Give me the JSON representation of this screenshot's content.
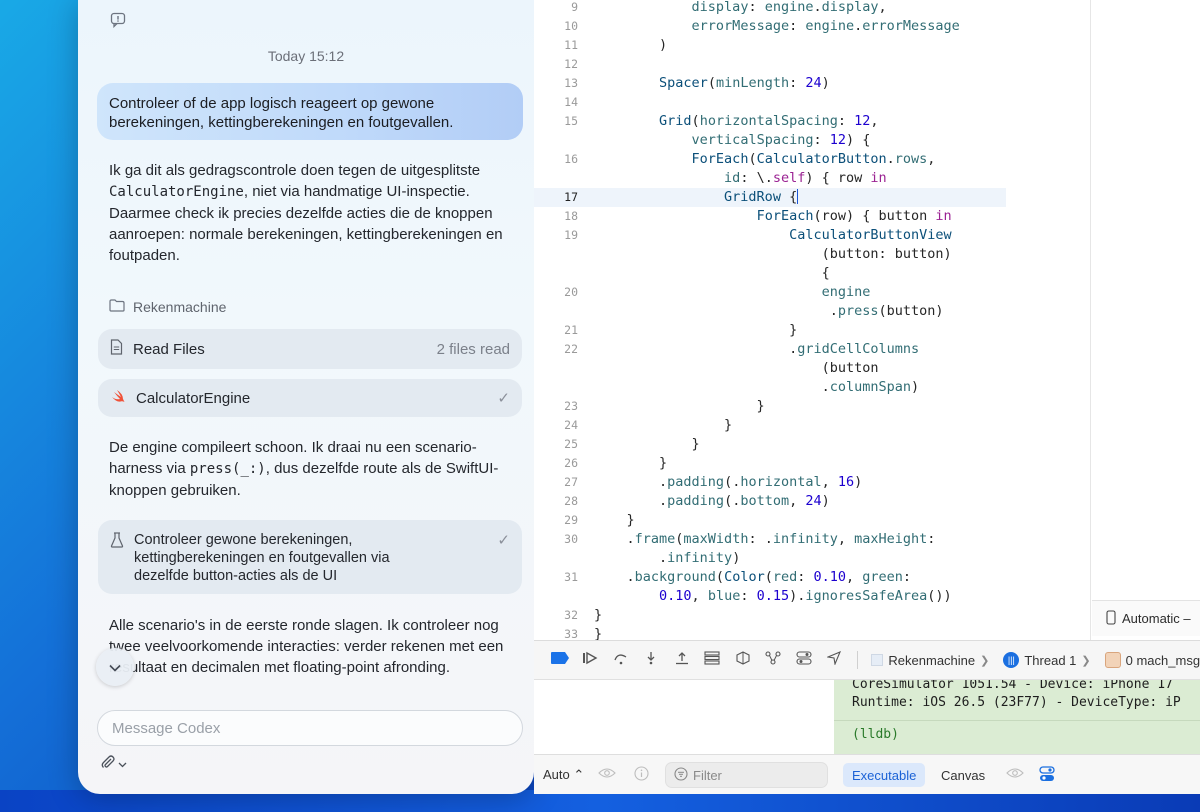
{
  "chat": {
    "timestamp": "Today 15:12",
    "user_message": "Controleer of de app logisch reageert op gewone berekeningen, kettingberekeningen en foutgevallen.",
    "reply1": {
      "part1": "Ik ga dit als gedragscontrole doen tegen de uitgesplitste ",
      "code": "CalculatorEngine",
      "part2": ", niet via handmatige UI-inspectie. Daarmee check ik precies dezelfde acties die de knoppen aanroepen: normale berekeningen, kettingberekeningen en foutpaden."
    },
    "folder_label": "Rekenmachine",
    "read_files": {
      "label": "Read Files",
      "meta": "2 files read"
    },
    "engine_card": {
      "label": "CalculatorEngine",
      "check": "✓"
    },
    "reply2": {
      "part1": "De engine compileert schoon. Ik draai nu een scenario-harness via ",
      "code": "press(_:)",
      "part2": ", dus dezelfde route als de SwiftUI-knoppen gebruiken."
    },
    "test_card": {
      "line1": "Controleer gewone berekeningen,",
      "line2": "kettingberekeningen en foutgevallen via",
      "line3": "dezelfde button-acties als de UI",
      "check": "✓"
    },
    "reply3": "Alle scenario's in de eerste ronde slagen. Ik controleer nog twee veelvoorkomende interacties: verder rekenen met een resultaat en decimalen met floating-point afronding.",
    "input_placeholder": "Message Codex"
  },
  "editor": {
    "lines": [
      {
        "n": "9",
        "html": "            display: engine.display,"
      },
      {
        "n": "10",
        "html": "            errorMessage: engine.errorMessage"
      },
      {
        "n": "11",
        "html": "        )"
      },
      {
        "n": "12",
        "html": ""
      },
      {
        "n": "13",
        "html": "        Spacer(minLength: 24)"
      },
      {
        "n": "14",
        "html": ""
      },
      {
        "n": "15",
        "html": "        Grid(horizontalSpacing: 12,"
      },
      {
        "n": "",
        "html": "            verticalSpacing: 12) {"
      },
      {
        "n": "16",
        "html": "            ForEach(CalculatorButton.rows,"
      },
      {
        "n": "",
        "html": "                id: \\.self) { row in"
      },
      {
        "n": "17",
        "html": "                GridRow {"
      },
      {
        "n": "18",
        "html": "                    ForEach(row) { button in"
      },
      {
        "n": "19",
        "html": "                        CalculatorButtonView"
      },
      {
        "n": "",
        "html": "                            (button: button)"
      },
      {
        "n": "",
        "html": "                            {"
      },
      {
        "n": "20",
        "html": "                            engine"
      },
      {
        "n": "",
        "html": "                             .press(button)"
      },
      {
        "n": "21",
        "html": "                        }"
      },
      {
        "n": "22",
        "html": "                        .gridCellColumns"
      },
      {
        "n": "",
        "html": "                            (button"
      },
      {
        "n": "",
        "html": "                            .columnSpan)"
      },
      {
        "n": "23",
        "html": "                    }"
      },
      {
        "n": "24",
        "html": "                }"
      },
      {
        "n": "25",
        "html": "            }"
      },
      {
        "n": "26",
        "html": "        }"
      },
      {
        "n": "27",
        "html": "        .padding(.horizontal, 16)"
      },
      {
        "n": "28",
        "html": "        .padding(.bottom, 24)"
      },
      {
        "n": "29",
        "html": "    }"
      },
      {
        "n": "30",
        "html": "    .frame(maxWidth: .infinity, maxHeight:"
      },
      {
        "n": "",
        "html": "        .infinity)"
      },
      {
        "n": "31",
        "html": "    .background(Color(red: 0.10, green:"
      },
      {
        "n": "",
        "html": "        0.10, blue: 0.15).ignoresSafeArea())"
      },
      {
        "n": "32",
        "html": "}"
      },
      {
        "n": "33",
        "html": "}"
      }
    ],
    "active_line": "17",
    "device_label": "Automatic –"
  },
  "debug": {
    "scheme": "Rekenmachine",
    "thread": "Thread 1",
    "frame": "0 mach_msg"
  },
  "console": {
    "line1": "CoreSimulator 1051.54 - Device: iPhone 17",
    "line2": "Runtime: iOS 26.5 (23F77) - DeviceType: iP",
    "prompt": "(lldb)"
  },
  "bottom_bar": {
    "auto_label": "Auto ⌃",
    "filter_placeholder": "Filter",
    "executable": "Executable",
    "canvas": "Canvas"
  }
}
